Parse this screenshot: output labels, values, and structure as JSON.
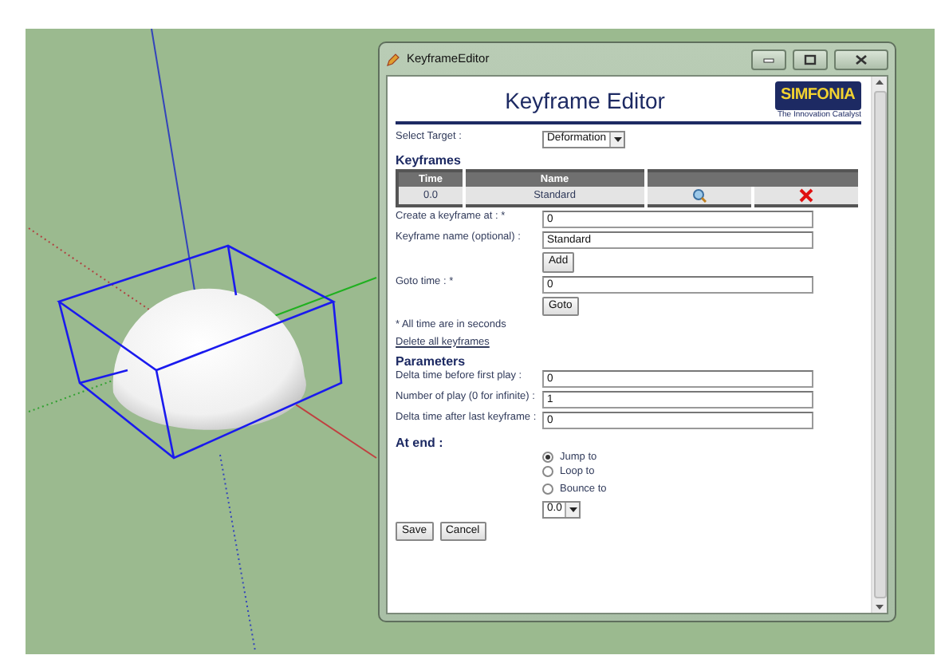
{
  "window": {
    "title": "KeyframeEditor"
  },
  "header": {
    "title": "Keyframe Editor",
    "logo": {
      "name": "SIMFONIA",
      "tagline": "The Innovation Catalyst"
    }
  },
  "target": {
    "label": "Select Target :",
    "value": "Deformation"
  },
  "keyframes": {
    "heading": "Keyframes",
    "columns": [
      "Time",
      "Name"
    ],
    "rows": [
      {
        "time": "0.0",
        "name": "Standard"
      }
    ]
  },
  "create_fields": [
    {
      "label": "Create a keyframe at : *",
      "value": "0"
    },
    {
      "label": "Keyframe name (optional) :",
      "value": "Standard"
    }
  ],
  "add_button": "Add",
  "goto": {
    "label": "Goto time : *",
    "value": "0",
    "button": "Goto"
  },
  "note": "* All time are in seconds",
  "delete_link": "Delete all keyframes",
  "parameters": {
    "heading": "Parameters",
    "fields": [
      {
        "label": "Delta time before first play :",
        "value": "0"
      },
      {
        "label": "Number of play (0 for infinite) :",
        "value": "1"
      },
      {
        "label": "Delta time after last keyframe :",
        "value": "0"
      }
    ]
  },
  "at_end": {
    "heading": "At end :",
    "options": [
      {
        "label": "Jump to",
        "selected": true
      },
      {
        "label": "Loop to",
        "selected": false
      },
      {
        "label": "Bounce to",
        "selected": false
      }
    ],
    "value": "0.0"
  },
  "buttons": [
    "Save",
    "Cancel"
  ]
}
